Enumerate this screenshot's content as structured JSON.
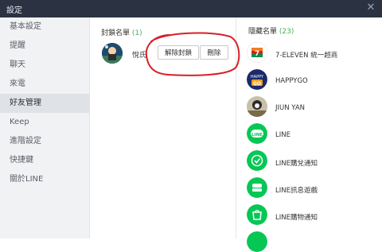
{
  "window": {
    "title": "設定"
  },
  "sidebar": {
    "items": [
      {
        "label": "基本設定"
      },
      {
        "label": "提醒"
      },
      {
        "label": "聊天"
      },
      {
        "label": "來電"
      },
      {
        "label": "好友管理",
        "active": true
      },
      {
        "label": "Keep"
      },
      {
        "label": "進階設定"
      },
      {
        "label": "快捷鍵"
      },
      {
        "label": "關於LINE"
      }
    ]
  },
  "blocked": {
    "title": "封鎖名單",
    "count": "(1)",
    "friend": {
      "name": "悅氏",
      "unblock_label": "解除封鎖",
      "delete_label": "刪除"
    }
  },
  "hidden": {
    "title": "隱藏名單",
    "count": "(23)",
    "items": [
      {
        "name": "7-ELEVEN 統一超商",
        "icon": "seven-eleven-logo"
      },
      {
        "name": "HAPPYGO",
        "icon": "happygo-logo"
      },
      {
        "name": "JIUN YAN",
        "icon": "photo-avatar"
      },
      {
        "name": "LINE",
        "icon": "line-logo"
      },
      {
        "name": "LINE購兌通知",
        "icon": "line-check-logo"
      },
      {
        "name": "LINE訊息遊戲",
        "icon": "line-news-logo"
      },
      {
        "name": "LINE購物通知",
        "icon": "line-shopping-logo"
      }
    ]
  },
  "colors": {
    "titlebar": "#2b3241",
    "line_green": "#06c755",
    "count_green": "#44b35a",
    "annotation_red": "#d81f26"
  }
}
